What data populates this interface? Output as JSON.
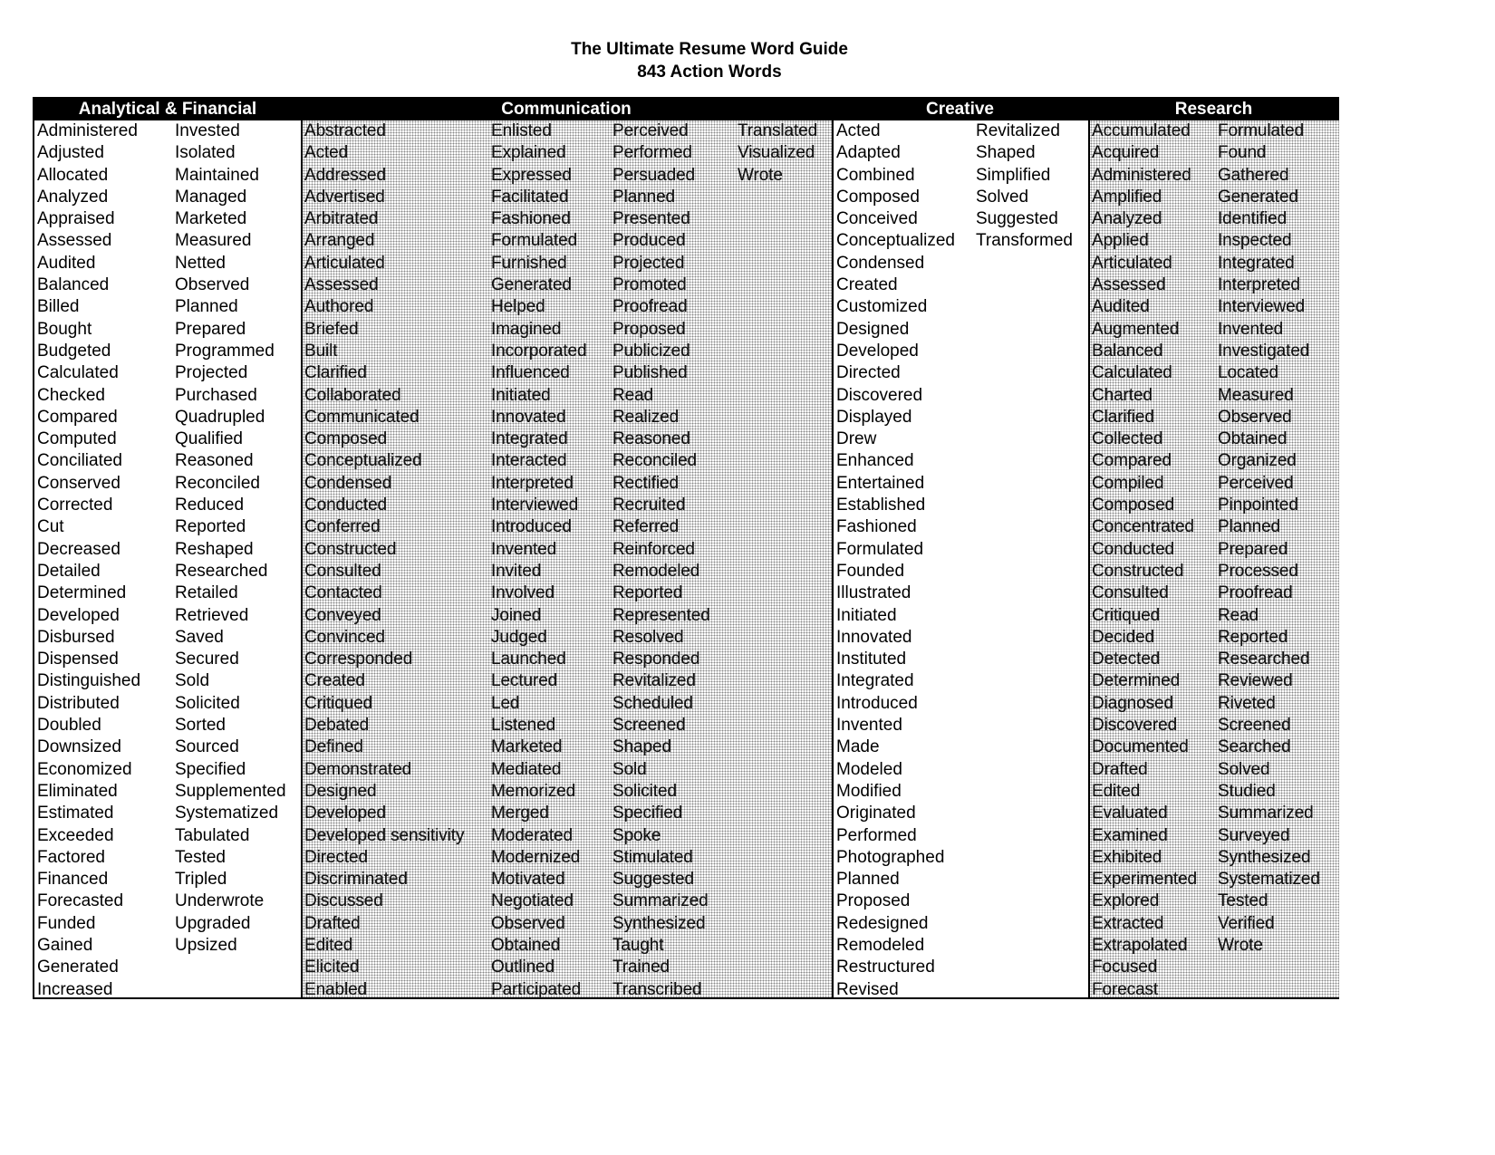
{
  "title": "The Ultimate Resume Word Guide",
  "subtitle": "843 Action Words",
  "sections": {
    "analytical": {
      "header": "Analytical & Financial",
      "columns": [
        [
          "Administered",
          "Adjusted",
          "Allocated",
          "Analyzed",
          "Appraised",
          "Assessed",
          "Audited",
          "Balanced",
          "Billed",
          "Bought",
          "Budgeted",
          "Calculated",
          "Checked",
          "Compared",
          "Computed",
          "Conciliated",
          "Conserved",
          "Corrected",
          "Cut",
          "Decreased",
          "Detailed",
          "Determined",
          "Developed",
          "Disbursed",
          "Dispensed",
          "Distinguished",
          "Distributed",
          "Doubled",
          "Downsized",
          "Economized",
          "Eliminated",
          "Estimated",
          "Exceeded",
          "Factored",
          "Financed",
          "Forecasted",
          "Funded",
          "Gained",
          "Generated",
          "Increased"
        ],
        [
          "Invested",
          "Isolated",
          "Maintained",
          "Managed",
          "Marketed",
          "Measured",
          "Netted",
          "Observed",
          "Planned",
          "Prepared",
          "Programmed",
          "Projected",
          "Purchased",
          "Quadrupled",
          "Qualified",
          "Reasoned",
          "Reconciled",
          "Reduced",
          "Reported",
          "Reshaped",
          "Researched",
          "Retailed",
          "Retrieved",
          "Saved",
          "Secured",
          "Sold",
          "Solicited",
          "Sorted",
          "Sourced",
          "Specified",
          "Supplemented",
          "Systematized",
          "Tabulated",
          "Tested",
          "Tripled",
          "Underwrote",
          "Upgraded",
          "Upsized"
        ]
      ]
    },
    "communication": {
      "header": "Communication",
      "columns": [
        [
          "Abstracted",
          "Acted",
          "Addressed",
          "Advertised",
          "Arbitrated",
          "Arranged",
          "Articulated",
          "Assessed",
          "Authored",
          "Briefed",
          "Built",
          "Clarified",
          "Collaborated",
          "Communicated",
          "Composed",
          "Conceptualized",
          "Condensed",
          "Conducted",
          "Conferred",
          "Constructed",
          "Consulted",
          "Contacted",
          "Conveyed",
          "Convinced",
          "Corresponded",
          "Created",
          "Critiqued",
          "Debated",
          "Defined",
          "Demonstrated",
          "Designed",
          "Developed",
          "Developed sensitivity",
          "Directed",
          "Discriminated",
          "Discussed",
          "Drafted",
          "Edited",
          "Elicited",
          "Enabled"
        ],
        [
          "Enlisted",
          "Explained",
          "Expressed",
          "Facilitated",
          "Fashioned",
          "Formulated",
          "Furnished",
          "Generated",
          "Helped",
          "Imagined",
          "Incorporated",
          "Influenced",
          "Initiated",
          "Innovated",
          "Integrated",
          "Interacted",
          "Interpreted",
          "Interviewed",
          "Introduced",
          "Invented",
          "Invited",
          "Involved",
          "Joined",
          "Judged",
          "Launched",
          "Lectured",
          "Led",
          "Listened",
          "Marketed",
          "Mediated",
          "Memorized",
          "Merged",
          "Moderated",
          "Modernized",
          "Motivated",
          "Negotiated",
          "Observed",
          "Obtained",
          "Outlined",
          "Participated"
        ],
        [
          "Perceived",
          "Performed",
          "Persuaded",
          "Planned",
          "Presented",
          "Produced",
          "Projected",
          "Promoted",
          "Proofread",
          "Proposed",
          "Publicized",
          "Published",
          "Read",
          "Realized",
          "Reasoned",
          "Reconciled",
          "Rectified",
          "Recruited",
          "Referred",
          "Reinforced",
          "Remodeled",
          "Reported",
          "Represented",
          "Resolved",
          "Responded",
          "Revitalized",
          "Scheduled",
          "Screened",
          "Shaped",
          "Sold",
          "Solicited",
          "Specified",
          "Spoke",
          "Stimulated",
          "Suggested",
          "Summarized",
          "Synthesized",
          "Taught",
          "Trained",
          "Transcribed"
        ],
        [
          "Translated",
          "Visualized",
          "Wrote"
        ]
      ]
    },
    "creative": {
      "header": "Creative",
      "columns": [
        [
          "Acted",
          "Adapted",
          "Combined",
          "Composed",
          "Conceived",
          "Conceptualized",
          "Condensed",
          "Created",
          "Customized",
          "Designed",
          "Developed",
          "Directed",
          "Discovered",
          "Displayed",
          "Drew",
          "Enhanced",
          "Entertained",
          "Established",
          "Fashioned",
          "Formulated",
          "Founded",
          "Illustrated",
          "Initiated",
          "Innovated",
          "Instituted",
          "Integrated",
          "Introduced",
          "Invented",
          "Made",
          "Modeled",
          "Modified",
          "Originated",
          "Performed",
          "Photographed",
          "Planned",
          "Proposed",
          "Redesigned",
          "Remodeled",
          "Restructured",
          "Revised"
        ],
        [
          "Revitalized",
          "Shaped",
          "Simplified",
          "Solved",
          "Suggested",
          "Transformed"
        ]
      ]
    },
    "research": {
      "header": "Research",
      "columns": [
        [
          "Accumulated",
          "Acquired",
          "Administered",
          "Amplified",
          "Analyzed",
          "Applied",
          "Articulated",
          "Assessed",
          "Audited",
          "Augmented",
          "Balanced",
          "Calculated",
          "Charted",
          "Clarified",
          "Collected",
          "Compared",
          "Compiled",
          "Composed",
          "Concentrated",
          "Conducted",
          "Constructed",
          "Consulted",
          "Critiqued",
          "Decided",
          "Detected",
          "Determined",
          "Diagnosed",
          "Discovered",
          "Documented",
          "Drafted",
          "Edited",
          "Evaluated",
          "Examined",
          "Exhibited",
          "Experimented",
          "Explored",
          "Extracted",
          "Extrapolated",
          "Focused",
          "Forecast"
        ],
        [
          "Formulated",
          "Found",
          "Gathered",
          "Generated",
          "Identified",
          "Inspected",
          "Integrated",
          "Interpreted",
          "Interviewed",
          "Invented",
          "Investigated",
          "Located",
          "Measured",
          "Observed",
          "Obtained",
          "Organized",
          "Perceived",
          "Pinpointed",
          "Planned",
          "Prepared",
          "Processed",
          "Proofread",
          "Read",
          "Reported",
          "Researched",
          "Reviewed",
          "Riveted",
          "Screened",
          "Searched",
          "Solved",
          "Studied",
          "Summarized",
          "Surveyed",
          "Synthesized",
          "Systematized",
          "Tested",
          "Verified",
          "Wrote"
        ]
      ]
    }
  }
}
